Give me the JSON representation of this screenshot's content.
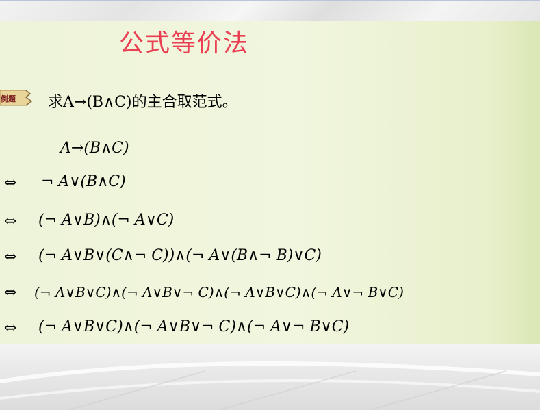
{
  "title": "公式等价法",
  "example_label": "例题",
  "problem": "求A→(B∧C)的主合取范式。",
  "derivation": {
    "start": "A→(B∧C)",
    "equiv_symbol": "⇔",
    "steps": [
      "¬ A∨(B∧C)",
      "(¬ A∨B)∧(¬ A∨C)",
      "(¬ A∨B∨(C∧¬ C))∧(¬ A∨(B∧¬ B)∨C)",
      "(¬ A∨B∨C)∧(¬ A∨B∨¬ C)∧(¬ A∨B∨C)∧(¬ A∨¬ B∨C)",
      "(¬ A∨B∨C)∧(¬ A∨B∨¬ C)∧(¬ A∨¬ B∨C)"
    ]
  },
  "colors": {
    "title": "#ea3f53",
    "slide_background": "#eef4d9"
  },
  "icons": {
    "example_tag": "scroll-tag-icon"
  }
}
